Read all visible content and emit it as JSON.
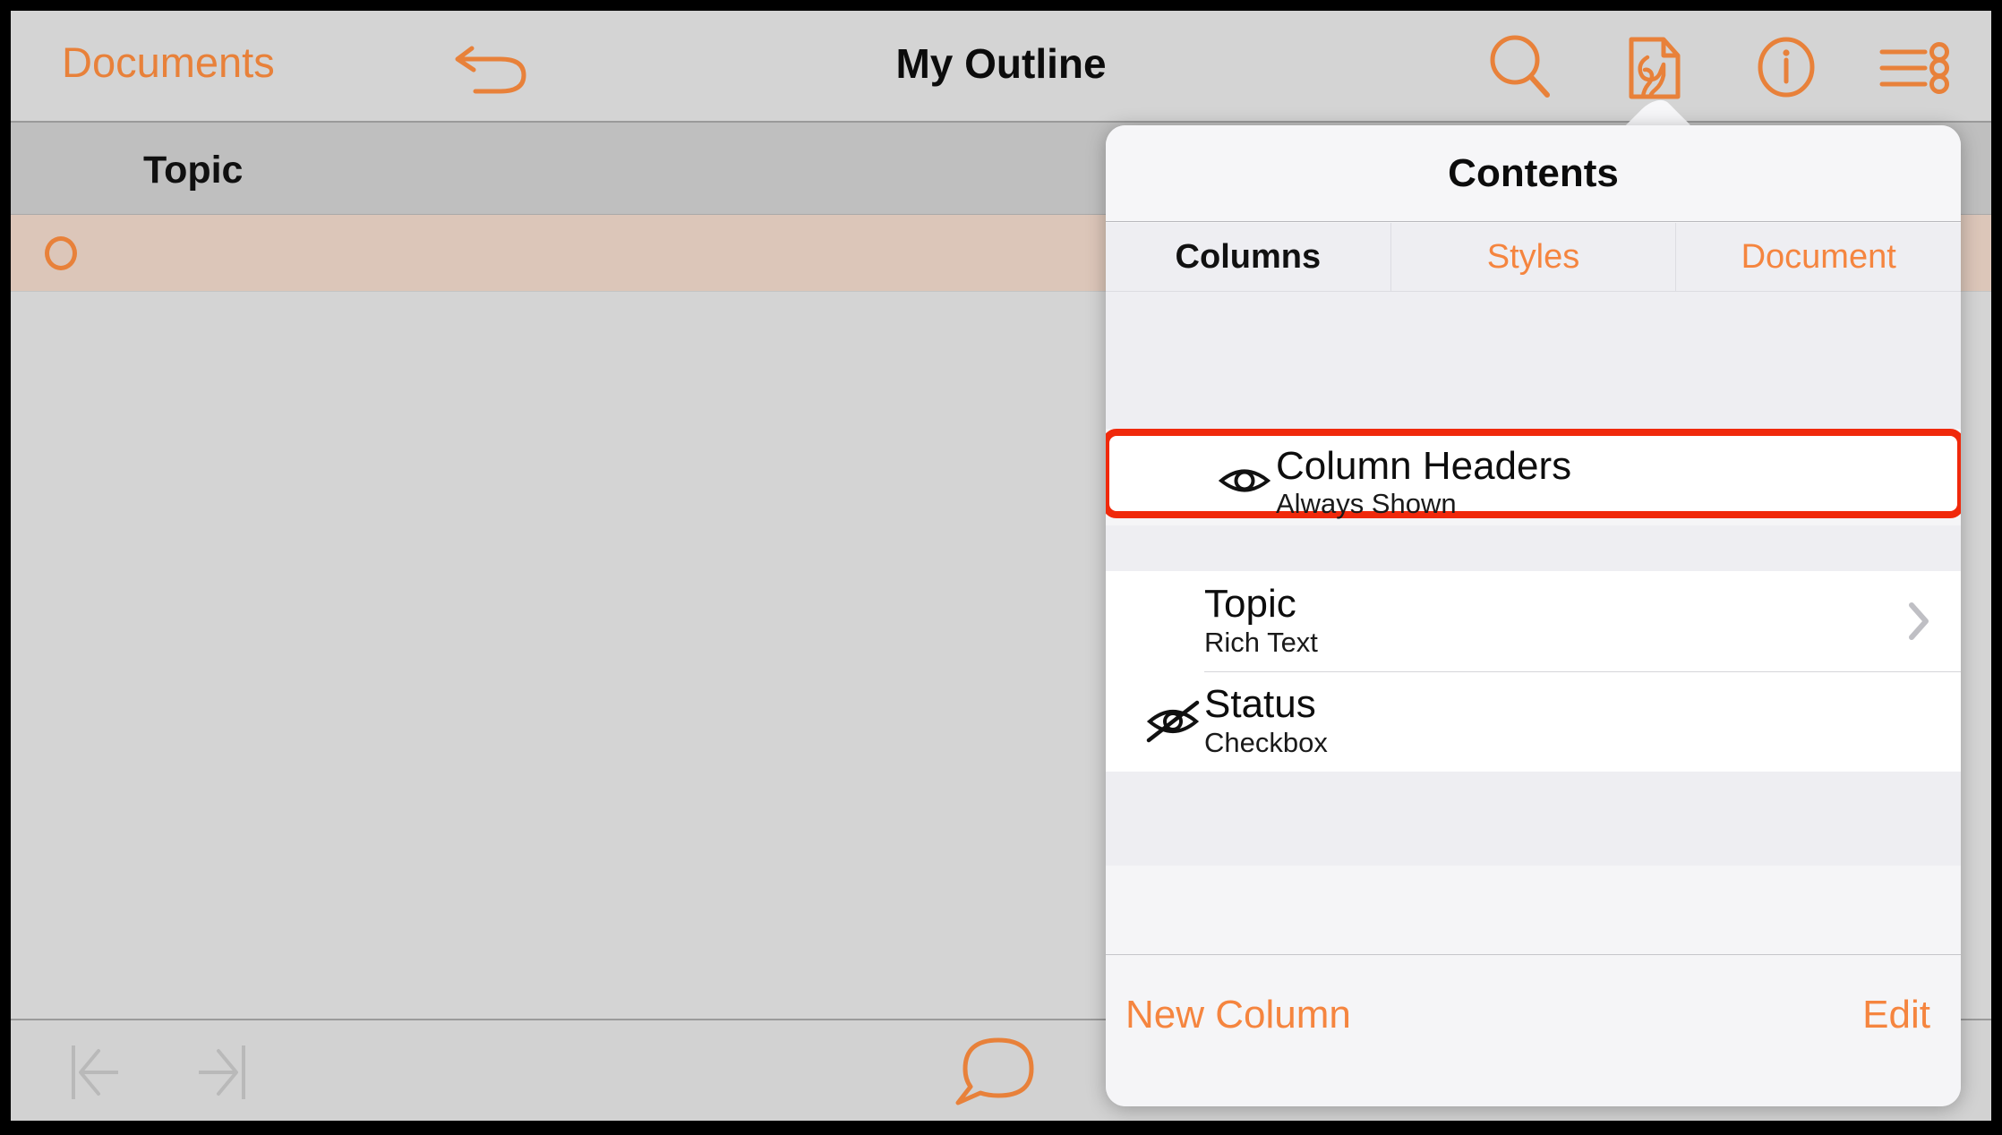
{
  "navbar": {
    "back_label": "Documents",
    "title": "My Outline",
    "undo_icon": "undo-arrow-icon",
    "search_icon": "search-icon",
    "contents_icon": "document-wrench-icon",
    "info_icon": "info-circle-icon",
    "list_icon": "list-options-icon"
  },
  "outline": {
    "column_header_label": "Topic",
    "resize_handle": "column-resize-handle",
    "row_bullet": "outline-row-bullet-circle"
  },
  "bottombar": {
    "outdent_icon": "outdent-icon",
    "indent_icon": "indent-icon",
    "comment_icon": "comment-bubble-icon"
  },
  "popover": {
    "title": "Contents",
    "tabs": [
      {
        "label": "Columns",
        "active": true
      },
      {
        "label": "Styles",
        "active": false
      },
      {
        "label": "Document",
        "active": false
      }
    ],
    "highlighted_card": {
      "title": "Column Headers",
      "subtitle": "Always Shown",
      "icon": "eye-visible-icon",
      "highlight_color": "#f0290b"
    },
    "rows": [
      {
        "title": "Topic",
        "subtitle": "Rich Text",
        "icon": null,
        "accessory": "chevron-right-icon"
      },
      {
        "title": "Status",
        "subtitle": "Checkbox",
        "icon": "eye-hidden-icon",
        "accessory": null
      }
    ],
    "footer": {
      "new_column_label": "New Column",
      "edit_label": "Edit"
    }
  },
  "colors": {
    "accent": "#e8813a",
    "tab_accent": "#f5853f",
    "highlight": "#f0290b",
    "chrome": "#d4d4d4",
    "header_row": "#bfbfbf",
    "selected_row": "#dcc6b9",
    "popover_bg": "#f5f5f7",
    "group_gap": "#eeeef2"
  }
}
